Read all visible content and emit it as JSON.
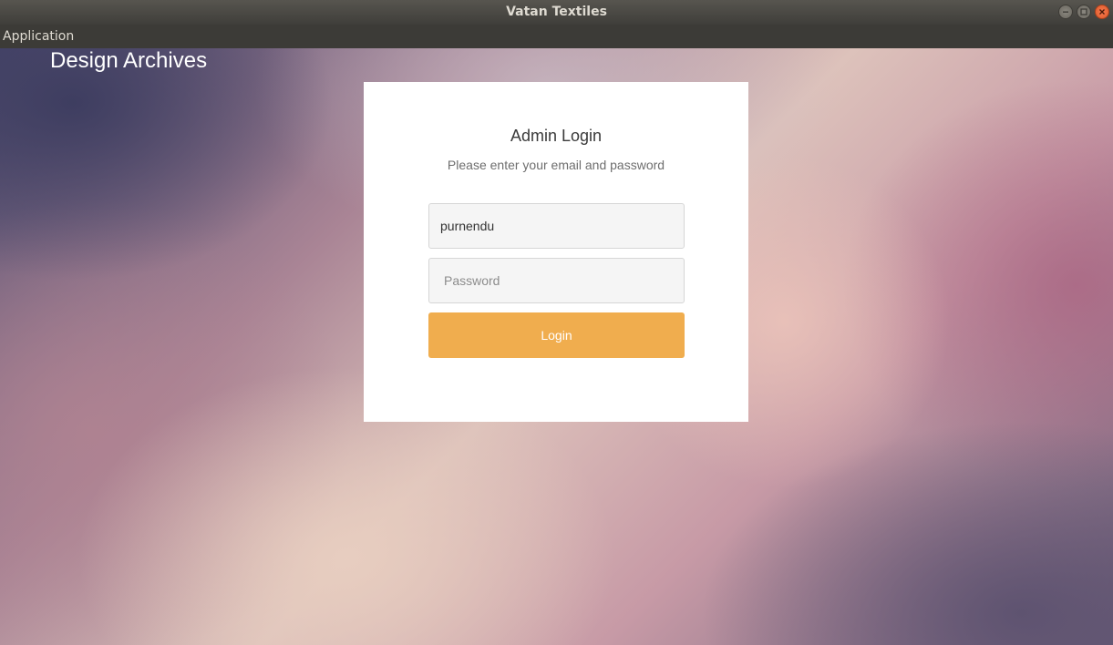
{
  "window": {
    "title": "Vatan Textiles",
    "controls": [
      "minimize-icon",
      "maximize-icon",
      "close-icon"
    ]
  },
  "menubar": {
    "items": [
      {
        "label": "Application"
      }
    ]
  },
  "header": {
    "brand": "Design Archives"
  },
  "login": {
    "title": "Admin Login",
    "subtitle": "Please enter your email and password",
    "username_value": "purnendu",
    "password_placeholder": "Password",
    "button_label": "Login"
  },
  "colors": {
    "accent": "#f0ad4e",
    "card_background": "#ffffff",
    "titlebar": "#3c3b37",
    "close_button": "#e95420"
  }
}
